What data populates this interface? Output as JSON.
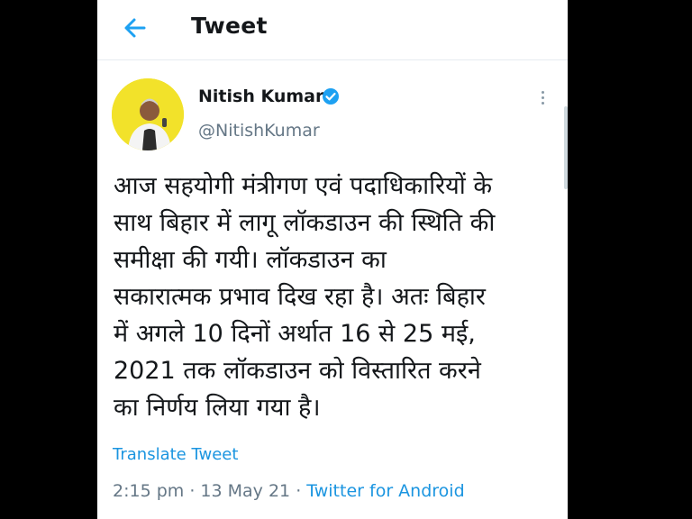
{
  "header": {
    "title": "Tweet",
    "back_icon": "arrow-left-icon"
  },
  "author": {
    "name": "Nitish Kumar",
    "handle": "@NitishKumar",
    "verified_icon": "verified-badge-icon"
  },
  "more_icon": "more-vertical-icon",
  "tweet": {
    "text": "आज सहयोगी मंत्रीगण एवं पदाधिकारियों के\nसाथ बिहार में लागू लॉकडाउन की स्थिति की\nसमीक्षा की गयी। लॉकडाउन का\nसकारात्मक प्रभाव दिख रहा है। अतः बिहार\nमें अगले 10 दिनों अर्थात 16 से 25 मई,\n2021 तक लॉकडाउन को विस्तारित करने\nका निर्णय लिया गया है।",
    "translate_label": "Translate Tweet",
    "time": "2:15 pm",
    "date": "13 May 21",
    "separator": "·",
    "source": "Twitter for Android"
  },
  "colors": {
    "accent": "#1da1f2",
    "link": "#1b95e0",
    "text": "#14171a",
    "secondary": "#657786",
    "avatar_bg": "#f2e22a"
  }
}
